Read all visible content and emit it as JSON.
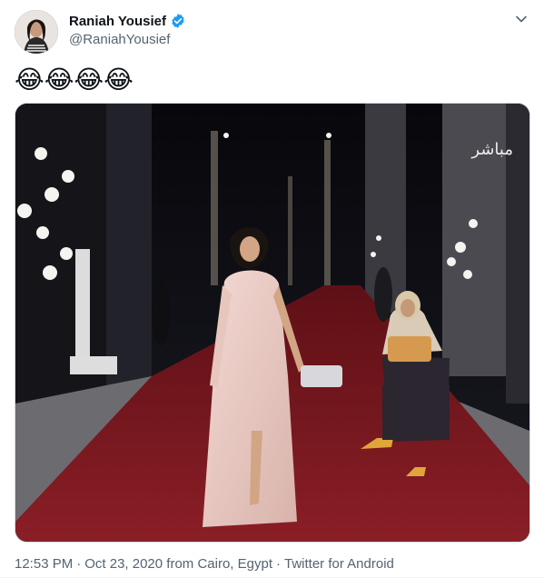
{
  "author": {
    "display_name": "Raniah Yousief",
    "handle": "@RaniahYousief",
    "verified": true
  },
  "tweet": {
    "text": "😂😂😂😂"
  },
  "media": {
    "overlay_text": "مباشر",
    "description_icon": "photo"
  },
  "meta": {
    "time": "12:53 PM",
    "separator": "·",
    "date_location": "Oct 23, 2020 from Cairo, Egypt",
    "separator2": "·",
    "source": "Twitter for Android"
  },
  "colors": {
    "verified": "#1d9bf0",
    "secondary_text": "#536471",
    "carpet": "#8a1e26"
  }
}
